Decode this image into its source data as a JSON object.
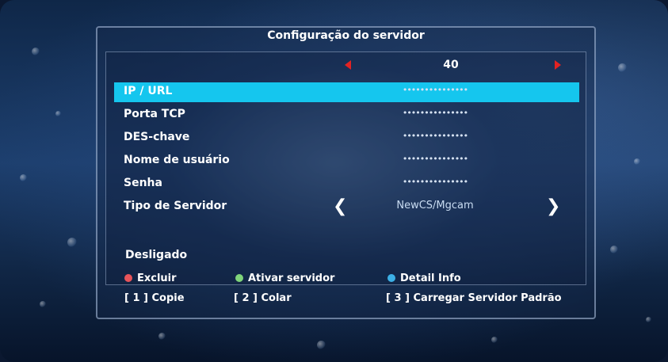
{
  "dialog": {
    "title": "Configuração do servidor"
  },
  "pager": {
    "current": "40"
  },
  "fields": [
    {
      "label": "IP / URL",
      "value": "•••••••••••••••"
    },
    {
      "label": "Porta TCP",
      "value": "•••••••••••••••"
    },
    {
      "label": "DES-chave",
      "value": "•••••••••••••••"
    },
    {
      "label": "Nome de usuário",
      "value": "•••••••••••••••"
    },
    {
      "label": "Senha",
      "value": "•••••••••••••••"
    },
    {
      "label": "Tipo de Servidor",
      "value": "NewCS/Mgcam"
    }
  ],
  "status": "Desligado",
  "legend": {
    "red": {
      "label": "Excluir",
      "color": "#e8545a"
    },
    "green": {
      "label": "Ativar servidor",
      "color": "#7fd47a"
    },
    "blue": {
      "label": "Detail Info",
      "color": "#3cb0e6"
    }
  },
  "keys": {
    "k1": "[ 1 ] Copie",
    "k2": "[ 2 ] Colar",
    "k3": "[ 3 ] Carregar Servidor Padrão"
  },
  "colors": {
    "highlight": "#15c6ee",
    "arrow": "#e32222"
  }
}
